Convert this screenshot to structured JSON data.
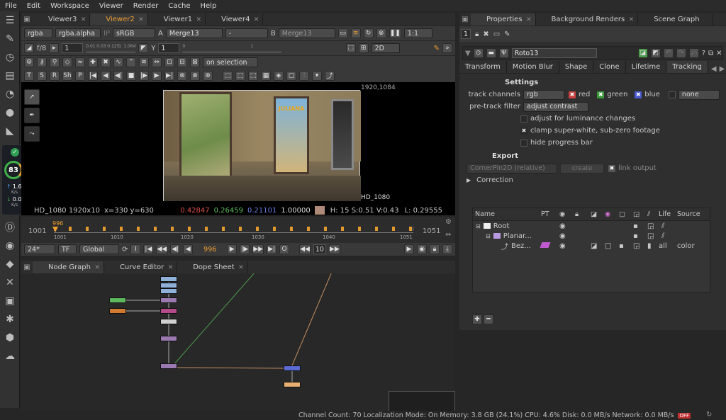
{
  "menu": [
    "File",
    "Edit",
    "Workspace",
    "Viewer",
    "Render",
    "Cache",
    "Help"
  ],
  "viewer_tabs": [
    {
      "label": "Viewer3"
    },
    {
      "label": "Viewer2"
    },
    {
      "label": "Viewer1"
    },
    {
      "label": "Viewer4"
    }
  ],
  "viewer_bar1": {
    "channels": "rgba",
    "alpha": "rgba.alpha",
    "ip": "IP",
    "lut": "sRGB",
    "a_label": "A",
    "a_input": "Merge13",
    "dash": "-",
    "b_label": "B",
    "b_input": "Merge13",
    "zoom": "1:1"
  },
  "viewer_bar2": {
    "fstop": "f/8",
    "gain": "1",
    "gain_ticks": [
      "0.01",
      "0.03",
      "0.125",
      "1",
      "1.064"
    ],
    "y_label": "Y",
    "gamma": "1",
    "gamma_ticks": [
      "0",
      "1"
    ],
    "mode": "2D"
  },
  "roto_bar": {
    "on_selection": "on selection",
    "letters": [
      "T",
      "S",
      "R",
      "Sh",
      "P"
    ]
  },
  "viewer": {
    "resolution": "1920,1084",
    "format": "HD_1080",
    "poster_text": "JULIANA"
  },
  "info": {
    "format": "HD_1080 1920x10",
    "coords": "x=330 y=630",
    "r": "0.42847",
    "g": "0.26459",
    "b": "0.21101",
    "a": "1.00000",
    "swatch": "#b08a78",
    "hsv": "H: 15 S:0.51 V:0.43",
    "lum": "L: 0.29555"
  },
  "timeline": {
    "start": "1001",
    "end": "1051",
    "current": "996",
    "ticks": [
      "1001",
      "1010",
      "1020",
      "1030",
      "1040",
      "1051"
    ]
  },
  "playback": {
    "fps": "24*",
    "tf": "TF",
    "global": "Global",
    "frame": "996",
    "inc": "10",
    "i_label": "I",
    "o_label": "O"
  },
  "node_tabs": [
    {
      "label": "Node Graph"
    },
    {
      "label": "Curve Editor"
    },
    {
      "label": "Dope Sheet"
    }
  ],
  "props_tabs": [
    {
      "label": "Properties"
    },
    {
      "label": "Background Renders"
    },
    {
      "label": "Scene Graph"
    }
  ],
  "props": {
    "max_panels": "1",
    "node_name": "Roto13",
    "subtabs": [
      "Transform",
      "Motion Blur",
      "Shape",
      "Clone",
      "Lifetime",
      "Tracking"
    ],
    "settings_title": "Settings",
    "track_channels_label": "track channels",
    "track_channels": "rgb",
    "ch_red": "red",
    "ch_green": "green",
    "ch_blue": "blue",
    "ch_none": "none",
    "pretrack_label": "pre-track filter",
    "pretrack": "adjust contrast",
    "opt_lum": "adjust for luminance changes",
    "opt_clamp": "clamp super-white, sub-zero footage",
    "opt_hide": "hide progress bar",
    "export_title": "Export",
    "export_select": "CornerPin2D (relative)",
    "create": "create",
    "link_output": "link output",
    "correction": "Correction",
    "table_headers": [
      "Name",
      "PT",
      "Life",
      "Source"
    ],
    "layers": [
      {
        "name": "Root"
      },
      {
        "name": "Planar..."
      },
      {
        "name": "Bez...",
        "life": "all",
        "source": "color"
      }
    ]
  },
  "status": {
    "text": "Channel Count: 70  Localization Mode: On  Memory: 3.8 GB (24.1%)  CPU: 4.6%  Disk: 0.0 MB/s  Network: 0.0 MB/s"
  },
  "widget": {
    "cpu": "83",
    "up": "1.6",
    "up_unit": "K/s",
    "down": "0.0",
    "down_unit": "K/s"
  },
  "colors": {
    "accent": "#f0a030",
    "red": "#e05050",
    "green": "#5ec05e",
    "blue": "#6a7ee0"
  }
}
